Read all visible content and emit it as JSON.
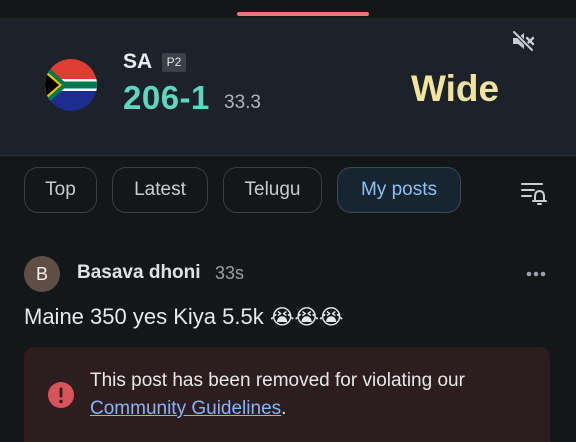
{
  "scorecard": {
    "team_code": "SA",
    "phase_badge": "P2",
    "score": "206-1",
    "overs": "33.3",
    "event": "Wide"
  },
  "tabs": [
    {
      "label": "Top"
    },
    {
      "label": "Latest"
    },
    {
      "label": "Telugu"
    },
    {
      "label": "My posts"
    }
  ],
  "post": {
    "avatar_letter": "B",
    "author": "Basava dhoni",
    "time": "33s",
    "text": "Maine 350 yes Kiya 5.5k",
    "emoji": "😭😭😭"
  },
  "removed_notice": {
    "text": "This post has been removed for violating our",
    "link": "Community Guidelines",
    "after": "."
  },
  "colors": {
    "background": "#141718",
    "panel": "#1c2229",
    "score": "#5fd6c0",
    "event": "#f2e39e",
    "accent": "#e8787a",
    "active_tab": "#8bc2f4",
    "warning": "#d8545a"
  },
  "icons": [
    "mute-icon",
    "filter-icon",
    "more-icon",
    "warning-icon",
    "south-africa-flag-icon"
  ]
}
